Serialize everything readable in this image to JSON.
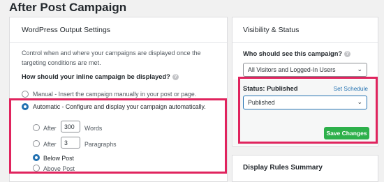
{
  "page": {
    "title": "After Post Campaign"
  },
  "left": {
    "header": "WordPress Output Settings",
    "description": "Control when and where your campaigns are displayed once the targeting conditions are met.",
    "question": "How should your inline campaign be displayed?",
    "options": {
      "manual": "Manual - Insert the campaign manually in your post or page.",
      "automatic": "Automatic - Configure and display your campaign automatically."
    },
    "sub": {
      "after_words_label": "After",
      "words_value": "300",
      "words_unit": "Words",
      "after_paragraphs_label": "After",
      "paragraphs_value": "3",
      "paragraphs_unit": "Paragraphs",
      "below_post": "Below Post",
      "above_post": "Above Post"
    },
    "selected": {
      "mode": "automatic",
      "position": "below_post"
    }
  },
  "right": {
    "header": "Visibility & Status",
    "who_label": "Who should see this campaign?",
    "who_value": "All Visitors and Logged-In Users",
    "status_label": "Status: Published",
    "set_schedule": "Set Schedule",
    "status_value": "Published",
    "save_button": "Save Changes",
    "next_header": "Display Rules Summary"
  },
  "colors": {
    "highlight": "#e0245e",
    "accent": "#2271b1",
    "save": "#2db04b"
  }
}
